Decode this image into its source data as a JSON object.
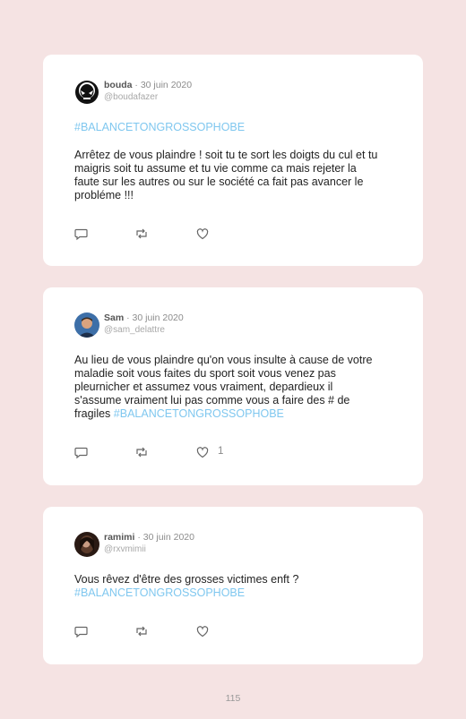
{
  "tweets": [
    {
      "author": "bouda",
      "date": " · 30 juin 2020",
      "handle": "@boudafazer",
      "hashtag_line": "#BALANCETONGROSSOPHOBE",
      "text": "Arrêtez de vous plaindre ! soit tu te sort les doigts du cul et tu maigris soit tu assume et tu vie comme ca mais rejeter la faute sur les autres ou sur le société ca fait pas avancer le probléme !!!",
      "avatar_icon": "alien-skull-avatar-icon",
      "like_count": ""
    },
    {
      "author": "Sam",
      "date": " · 30 juin 2020",
      "handle": "@sam_delattre",
      "text": "Au lieu de vous plaindre qu'on vous insulte à cause de votre maladie soit vous faites du sport soit vous venez pas pleurnicher et assumez vous vraiment, depardieux il s'assume vraiment lui pas comme vous a faire des # de fragiles ",
      "hashtag": "#BALANCETONGROSSOPHOBE",
      "avatar_icon": "profile-photo-avatar",
      "like_count": "1"
    },
    {
      "author": "ramimi",
      "date": " · 30 juin 2020",
      "handle": "@rxvmimii",
      "text": "Vous rêvez d'être des grosses victimes enft ?",
      "hashtag": "#BALANCETONGROSSOPHOBE",
      "avatar_icon": "profile-photo-avatar",
      "like_count": ""
    }
  ],
  "colors": {
    "hashtag": "#7fc7ef",
    "background": "#f5e3e3"
  },
  "page_number": "115"
}
